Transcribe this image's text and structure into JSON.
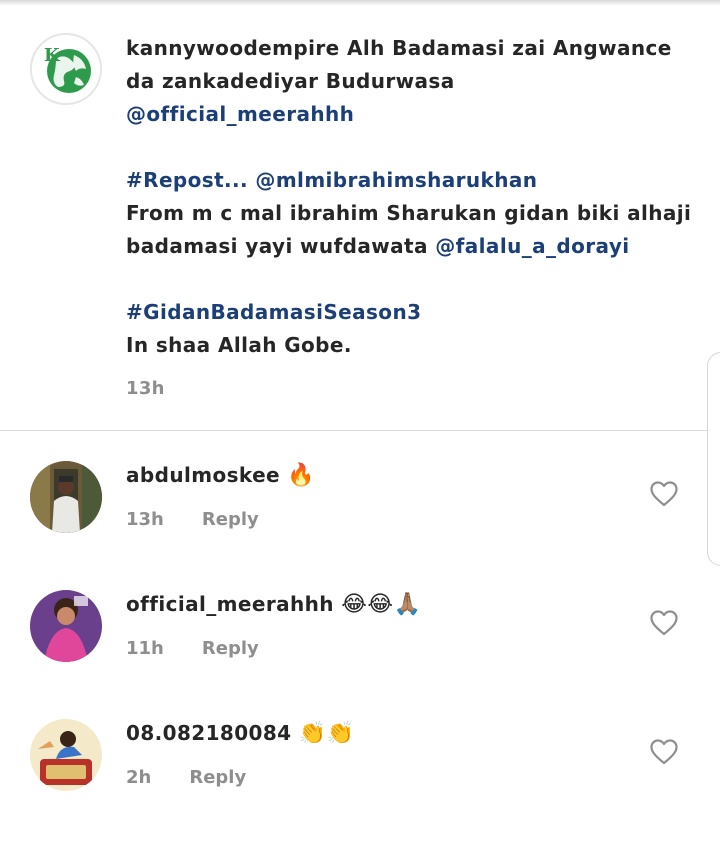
{
  "caption": {
    "username": "kannywoodempire",
    "lines": [
      " Alh Badamasi zai Angwance",
      "da zankadediyar Budurwasa"
    ],
    "mention1": "@official_meerahhh",
    "repost_tag": "#Repost...",
    "repost_mention": "@mlmibrahimsharukhan",
    "body1": "From m c mal ibrahim Sharukan gidan biki alhaji",
    "body2_prefix": "badamasi yayi wufdawata ",
    "mention2": "@falalu_a_dorayi",
    "hashtag": "#GidanBadamasiSeason3",
    "closing": "In shaa Allah Gobe.",
    "time": "13h"
  },
  "comments": [
    {
      "username": "abdulmoskee",
      "emoji": "🔥",
      "time": "13h",
      "reply_label": "Reply"
    },
    {
      "username": "official_meerahhh",
      "emoji": "😂😂🙏🏽",
      "time": "11h",
      "reply_label": "Reply"
    },
    {
      "username": "08.082180084",
      "emoji": "👏👏",
      "time": "2h",
      "reply_label": "Reply"
    }
  ],
  "icons": {
    "like": "heart-outline-icon",
    "caption_avatar": "globe-logo-avatar"
  },
  "colors": {
    "link": "#1c3f78",
    "text": "#262626",
    "muted": "#8e8e8e",
    "divider": "#dbdbdb"
  }
}
